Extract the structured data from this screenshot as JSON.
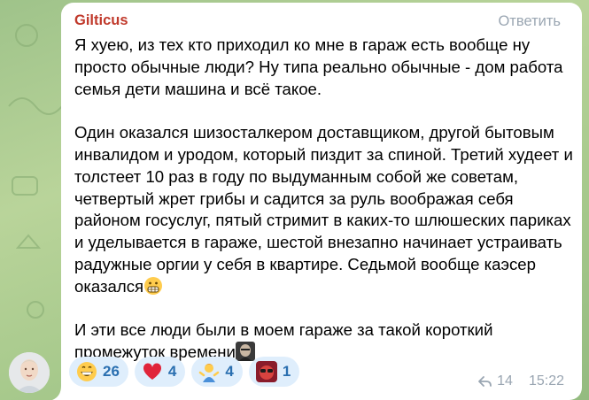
{
  "message": {
    "sender": "Gilticus",
    "reply_label": "Ответить",
    "paragraphs": [
      "Я хуею, из тех кто приходил ко мне в гараж есть вообще ну просто обычные люди? Ну типа реально обычные - дом работа семья дети машина и всё такое.",
      "Один оказался шизосталкером доставщиком, другой бытовым инвалидом и уродом, который пиздит за спиной. Третий худеет и толстеет 10 раз в году по выдуманным собой же советам, четвертый жрет грибы и садится за руль воображая себя районом госуслуг, пятый стримит в каких-то шлюшеских париках и уделывается в гараже, шестой внезапно начинает устраивать радужные оргии у себя в квартире. Седьмой вообще каэсер оказался",
      "И эти все люди были в моем гараже за такой короткий промежуток времени"
    ],
    "reactions": [
      {
        "emoji": "grinning-face",
        "count": "26"
      },
      {
        "emoji": "red-heart",
        "count": "4"
      },
      {
        "emoji": "person-shrugging",
        "count": "4"
      },
      {
        "emoji": "custom-sticker",
        "count": "1"
      }
    ],
    "views": "14",
    "time": "15:22"
  },
  "colors": {
    "sender": "#c0392b",
    "reaction_bg": "#dfeefc",
    "reaction_text": "#2a6fb0",
    "meta": "#9aa6b2"
  }
}
